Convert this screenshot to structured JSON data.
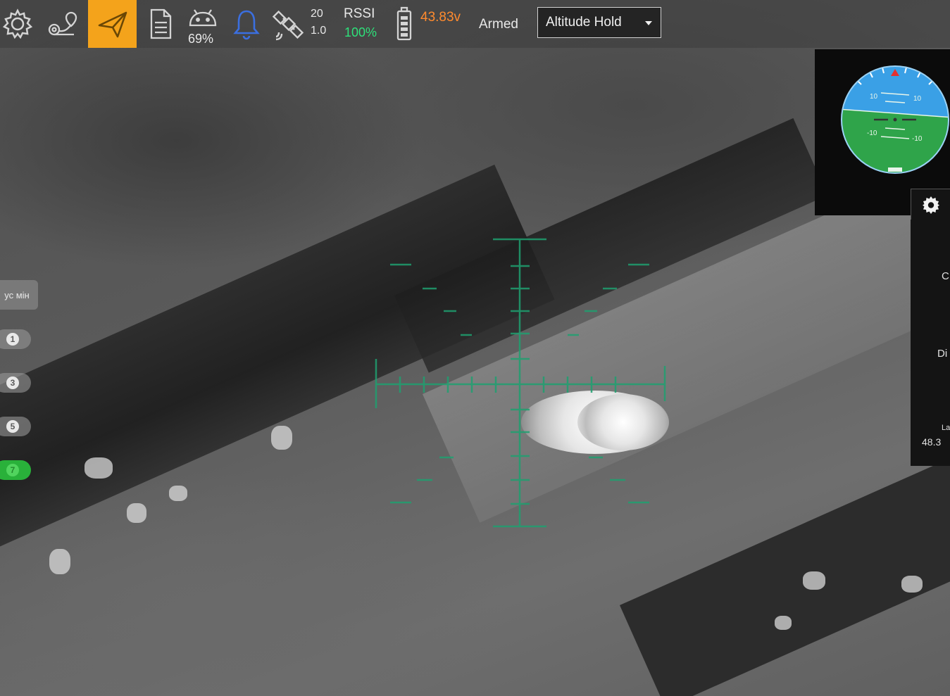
{
  "toolbar": {
    "icons": [
      "gear-icon",
      "waypoint-route-icon",
      "paper-plane-icon",
      "document-icon",
      "android-icon",
      "bell-icon",
      "satellite-icon",
      "battery-icon"
    ],
    "phone_battery": "69%",
    "gps_satellites": "20",
    "gps_hdop": "1.0",
    "rssi_label": "RSSI",
    "rssi_value": "100%",
    "battery_voltage": "43.83v",
    "arm_status": "Armed",
    "flight_mode": "Altitude Hold",
    "active_color": "#f4a31b",
    "voltage_color": "#ff8b2e",
    "rssi_color": "#2ee07a"
  },
  "left_panel": {
    "min_button_label": "ус мін",
    "quick_buttons": [
      "1",
      "3",
      "5",
      "7"
    ],
    "active_quick_button": "7",
    "active_color": "#29b13a"
  },
  "instruments": {
    "attitude_scale": [
      "10",
      "10",
      "-10",
      "-10"
    ],
    "sky_color": "#3aa0e6",
    "ground_color": "#2fa44a",
    "settings_icon": "gear-icon"
  },
  "values_panel": {
    "labels": [
      "C",
      "Di",
      "La"
    ],
    "lat_value": "48.3"
  },
  "crosshair": {
    "color": "#1fa070"
  }
}
